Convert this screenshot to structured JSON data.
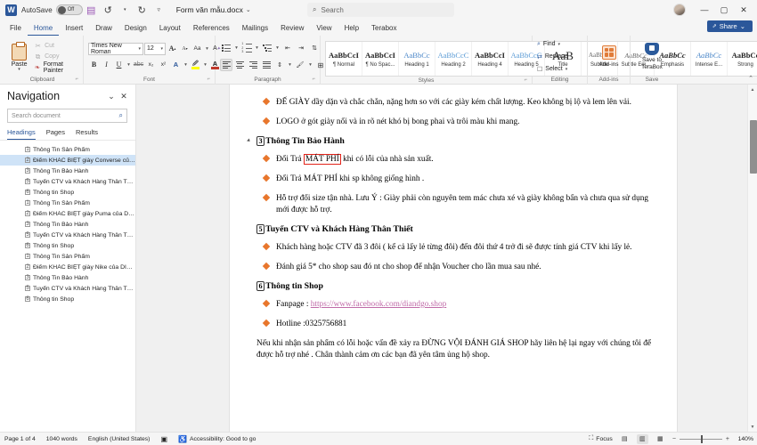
{
  "titlebar": {
    "app_logo": "W",
    "autosave_label": "AutoSave",
    "autosave_state": "Off",
    "save_icon": "save-icon",
    "undo_icon": "undo-icon",
    "redo_icon": "redo-icon",
    "more_icon": "more-commands-icon",
    "document_title": "Form văn mẫu.docx",
    "title_caret": "⌄",
    "search_placeholder": "Search",
    "minimize": "—",
    "maximize": "▢",
    "close": "✕"
  },
  "menu": {
    "tabs": [
      {
        "label": "File",
        "active": false
      },
      {
        "label": "Home",
        "active": true
      },
      {
        "label": "Insert",
        "active": false
      },
      {
        "label": "Draw",
        "active": false
      },
      {
        "label": "Design",
        "active": false
      },
      {
        "label": "Layout",
        "active": false
      },
      {
        "label": "References",
        "active": false
      },
      {
        "label": "Mailings",
        "active": false
      },
      {
        "label": "Review",
        "active": false
      },
      {
        "label": "View",
        "active": false
      },
      {
        "label": "Help",
        "active": false
      },
      {
        "label": "Terabox",
        "active": false
      }
    ],
    "share_label": "Share",
    "share_caret": "⌄"
  },
  "ribbon": {
    "clipboard": {
      "group_label": "Clipboard",
      "paste_label": "Paste",
      "paste_caret": "▾",
      "cut_label": "Cut",
      "copy_label": "Copy",
      "format_painter_label": "Format Painter"
    },
    "font": {
      "group_label": "Font",
      "font_name": "Times New Roman",
      "font_size": "12",
      "grow_font": "A",
      "shrink_font": "A",
      "change_case": "Aa",
      "clear_formatting": "A",
      "bold": "B",
      "italic": "I",
      "underline": "U",
      "strikethrough": "abc",
      "subscript": "x₂",
      "superscript": "x²",
      "text_effects": "A",
      "highlight": "A",
      "font_color": "A",
      "font_color_hex": "#c0392b",
      "highlight_hex": "#ffff00"
    },
    "paragraph": {
      "group_label": "Paragraph",
      "bullets": "bullets-icon",
      "numbering": "numbering-icon",
      "multilevel": "multilevel-list-icon",
      "decrease_indent": "decrease-indent-icon",
      "increase_indent": "increase-indent-icon",
      "sort": "sort-icon",
      "show_marks": "¶",
      "align_left": "align-left-icon",
      "align_center": "align-center-icon",
      "align_right": "align-right-icon",
      "justify": "justify-icon",
      "line_spacing": "line-spacing-icon",
      "shading": "shading-icon",
      "borders": "borders-icon"
    },
    "styles": {
      "group_label": "Styles",
      "items": [
        {
          "preview": "AaBbCcI",
          "name": "¶ Normal"
        },
        {
          "preview": "AaBbCcI",
          "name": "¶ No Spac..."
        },
        {
          "preview": "AaBbCc",
          "name": "Heading 1"
        },
        {
          "preview": "AaBbCcC",
          "name": "Heading 2"
        },
        {
          "preview": "AaBbCcI",
          "name": "Heading 4"
        },
        {
          "preview": "AaBbCcC",
          "name": "Heading 5"
        },
        {
          "preview": "AaB",
          "name": "Title"
        },
        {
          "preview": "AaBbCc",
          "name": "Subtitle"
        },
        {
          "preview": "AaBbCc",
          "name": "Subtle Em..."
        },
        {
          "preview": "AaBbCc",
          "name": "Emphasis"
        },
        {
          "preview": "AaBbCc",
          "name": "Intense E..."
        },
        {
          "preview": "AaBbCc",
          "name": "Strong"
        }
      ],
      "scroll_up": "▲",
      "scroll_down": "▼",
      "scroll_more": "▤"
    },
    "editing": {
      "group_label": "Editing",
      "find_label": "Find",
      "find_caret": "▾",
      "replace_label": "Replace",
      "select_label": "Select",
      "select_caret": "▾"
    },
    "addins": {
      "group_label": "Add-ins",
      "button_label": "Add-ins"
    },
    "save_group": {
      "group_label": "Save",
      "button_label_line1": "Save to",
      "button_label_line2": "TeraBox"
    },
    "collapse_caret": "⌃"
  },
  "navigation": {
    "title": "Navigation",
    "chevron": "⌄",
    "close": "✕",
    "search_placeholder": "Search document",
    "search_icon": "search-icon",
    "tabs": [
      {
        "label": "Headings",
        "active": true
      },
      {
        "label": "Pages",
        "active": false
      },
      {
        "label": "Results",
        "active": false
      }
    ],
    "items": [
      {
        "label": "Thông Tin Sản Phẩm",
        "level": "1",
        "selected": false
      },
      {
        "label": "Điểm KHÁC BIỆT giày Converse của DIA...",
        "level": "2",
        "selected": true
      },
      {
        "label": "Thông Tin Bảo Hành",
        "level": "3",
        "selected": false
      },
      {
        "label": "Tuyển CTV và Khách Hàng Thân Thiết",
        "level": "5",
        "selected": false
      },
      {
        "label": "Thông tin Shop",
        "level": "6",
        "selected": false
      },
      {
        "label": "Thông Tin Sản Phẩm",
        "level": "1",
        "selected": false
      },
      {
        "label": "Điểm KHÁC BIỆT giày Puma của DIANDG...",
        "level": "2",
        "selected": false
      },
      {
        "label": "Thông Tin Bảo Hành",
        "level": "3",
        "selected": false
      },
      {
        "label": "Tuyển CTV và Khách Hàng Thân Thiết",
        "level": "5",
        "selected": false
      },
      {
        "label": "Thông tin Shop",
        "level": "6",
        "selected": false
      },
      {
        "label": "Thông Tin Sản Phẩm",
        "level": "1",
        "selected": false
      },
      {
        "label": "Điểm KHÁC BIỆT giày Nike của DIANDG...",
        "level": "2",
        "selected": false
      },
      {
        "label": "Thông Tin Bảo Hành",
        "level": "3",
        "selected": false
      },
      {
        "label": "Tuyển CTV và Khách Hàng Thân Thiết",
        "level": "5",
        "selected": false
      },
      {
        "label": "Thông tin Shop",
        "level": "6",
        "selected": false
      }
    ]
  },
  "document": {
    "blocks": [
      {
        "type": "bullet",
        "text": "ĐẾ GIÀY dầy dặn và chắc chắn, nặng hơn so với các giày kém chất lượng. Keo không bị lộ và lem lên vải."
      },
      {
        "type": "bullet",
        "text": "LOGO ở gót giày nổi và in rõ nét khó bị bong phai và trôi màu khi mang."
      },
      {
        "type": "heading",
        "number": "3",
        "text": "Thông Tin Bảo Hành",
        "collapsible": true
      },
      {
        "type": "bullet-highlight",
        "pre": "Đổi Trả ",
        "boxed": "MÁT PHÍ",
        "post": " khi có lỗi của nhà sản xuất."
      },
      {
        "type": "bullet",
        "text": "Đổi Trả MÁT PHÍ khi sp không giống hình ."
      },
      {
        "type": "bullet",
        "text": "Hỗ trợ đổi size tận nhà. Lưu Ý : Giày phải còn nguyên tem mác chưa xé và giày không bẩn và chưa qua sử dụng mới được hỗ trợ."
      },
      {
        "type": "heading",
        "number": "5",
        "text": "Tuyển CTV và Khách Hàng Thân Thiết",
        "collapsible": false
      },
      {
        "type": "bullet",
        "text": "Khách hàng hoặc CTV đã 3 đôi ( kể cả lấy lẻ từng đôi) đến đôi thứ 4 trở đi sẽ được tính giá CTV khi lấy lẻ."
      },
      {
        "type": "bullet",
        "text": "Đánh giá 5* cho shop sau đó nt cho shop để nhận Voucher cho lần mua sau nhé."
      },
      {
        "type": "heading",
        "number": "6",
        "text": "Thông tin Shop",
        "collapsible": false
      },
      {
        "type": "bullet-link",
        "pre": "Fanpage : ",
        "link": "https://www.facebook.com/diandgo.shop"
      },
      {
        "type": "bullet",
        "text": "Hotline :0325756881"
      },
      {
        "type": "plain",
        "text": "Nếu khi nhận sản phẩm có lỗi hoặc vấn đề xảy ra ĐỪNG VỘI ĐÁNH GIÁ SHOP hãy liên hệ lại ngay với chúng tôi để được hỗ trợ nhé . Chân thành cảm ơn các bạn đã yên tâm ủng hộ shop."
      }
    ]
  },
  "statusbar": {
    "page_info": "Page 1 of 4",
    "word_count": "1040 words",
    "language": "English (United States)",
    "proofing_icon": "proofing-icon",
    "accessibility_icon": "accessibility-icon",
    "accessibility_label": "Accessibility: Good to go",
    "focus_label": "Focus",
    "focus_icon": "focus-icon",
    "read_mode_icon": "read-mode-icon",
    "print_layout_icon": "print-layout-icon",
    "web_layout_icon": "web-layout-icon",
    "zoom_out": "−",
    "zoom_in": "+",
    "zoom_level": "140%"
  }
}
